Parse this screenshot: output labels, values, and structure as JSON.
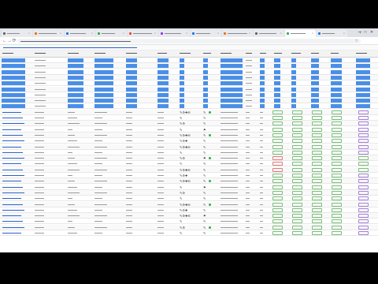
{
  "browser": {
    "tab_count": 11,
    "active_tab": 9,
    "window_controls": [
      "−",
      "□",
      "✕"
    ],
    "new_tab_glyph": "+",
    "nav_glyphs": [
      "←",
      "→",
      "⟳"
    ],
    "bookmark_glyph": "☆"
  },
  "table": {
    "column_count": 16,
    "row_count": 31,
    "selected_rows": [
      0,
      1,
      2,
      3,
      4,
      5,
      6,
      7,
      8
    ],
    "red_status_rows": [
      17,
      18,
      19
    ],
    "purple_status_rows": [
      9,
      10,
      11,
      12,
      13,
      14,
      15,
      16,
      20,
      21,
      22,
      23,
      24,
      25,
      26,
      27,
      28,
      29,
      30
    ]
  },
  "colors": {
    "link": "#2a62c9",
    "selection": "#4a8fe7",
    "status_ok": "#7bbf7b",
    "status_warn": "#e07b7b",
    "status_alt": "#a582d6"
  }
}
